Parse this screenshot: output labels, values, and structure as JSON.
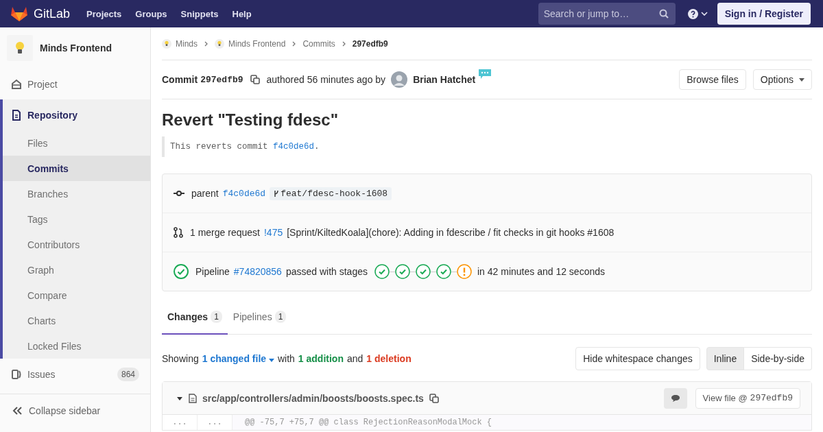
{
  "navbar": {
    "brand": "GitLab",
    "links": [
      "Projects",
      "Groups",
      "Snippets",
      "Help"
    ],
    "search": {
      "placeholder": "Search or jump to…"
    },
    "sign_in": "Sign in / Register"
  },
  "sidebar": {
    "project_name": "Minds Frontend",
    "items": [
      {
        "label": "Project",
        "selected": false
      },
      {
        "label": "Repository",
        "selected": true,
        "children": [
          {
            "label": "Files",
            "selected": false
          },
          {
            "label": "Commits",
            "selected": true
          },
          {
            "label": "Branches",
            "selected": false
          },
          {
            "label": "Tags",
            "selected": false
          },
          {
            "label": "Contributors",
            "selected": false
          },
          {
            "label": "Graph",
            "selected": false
          },
          {
            "label": "Compare",
            "selected": false
          },
          {
            "label": "Charts",
            "selected": false
          },
          {
            "label": "Locked Files",
            "selected": false
          }
        ]
      },
      {
        "label": "Issues",
        "selected": false,
        "count": "864"
      }
    ],
    "collapse": "Collapse sidebar"
  },
  "breadcrumbs": [
    "Minds",
    "Minds Frontend",
    "Commits",
    "297edfb9"
  ],
  "commit": {
    "label": "Commit",
    "sha": "297edfb9",
    "authored": "authored 56 minutes ago by",
    "author": "Brian Hatchet",
    "buttons": [
      "Browse files",
      "Options"
    ],
    "title": "Revert \"Testing fdesc\"",
    "description": {
      "text": "This reverts commit",
      "link": "f4c0de6d",
      "end": "."
    }
  },
  "info": {
    "parent": {
      "label": "parent",
      "sha": "f4c0de6d",
      "branch": "feat/fdesc-hook-1608"
    },
    "merge_request": {
      "label": "1 merge request",
      "link": "!475",
      "title": "[Sprint/KiltedKoala](chore): Adding in fdescribe / fit checks in git hooks #1608"
    },
    "pipeline": {
      "label": "Pipeline",
      "link": "#74820856",
      "status_text": "passed with stages",
      "stages": [
        {
          "kind": "success"
        },
        {
          "kind": "success"
        },
        {
          "kind": "success"
        },
        {
          "kind": "success"
        },
        {
          "kind": "warning"
        }
      ],
      "duration": "in 42 minutes and 12 seconds"
    }
  },
  "tabs": [
    {
      "label": "Changes",
      "count": "1",
      "selected": true
    },
    {
      "label": "Pipelines",
      "count": "1",
      "selected": false
    }
  ],
  "summary": {
    "showing": "Showing",
    "files": "1 changed file",
    "with": "with",
    "additions": "1 addition",
    "and": "and",
    "deletions": "1 deletion"
  },
  "whitespace_button": "Hide whitespace changes",
  "view_modes": [
    {
      "label": "Inline",
      "selected": true
    },
    {
      "label": "Side-by-side",
      "selected": false
    }
  ],
  "file": {
    "path": "src/app/controllers/admin/boosts/boosts.spec.ts",
    "view_file": "View file @",
    "sha": "297edfb9",
    "expanded": true,
    "lines": [
      {
        "old": "...",
        "new": "...",
        "text": "@@ -75,7 +75,7 @@ class RejectionReasonModalMock {"
      }
    ]
  }
}
